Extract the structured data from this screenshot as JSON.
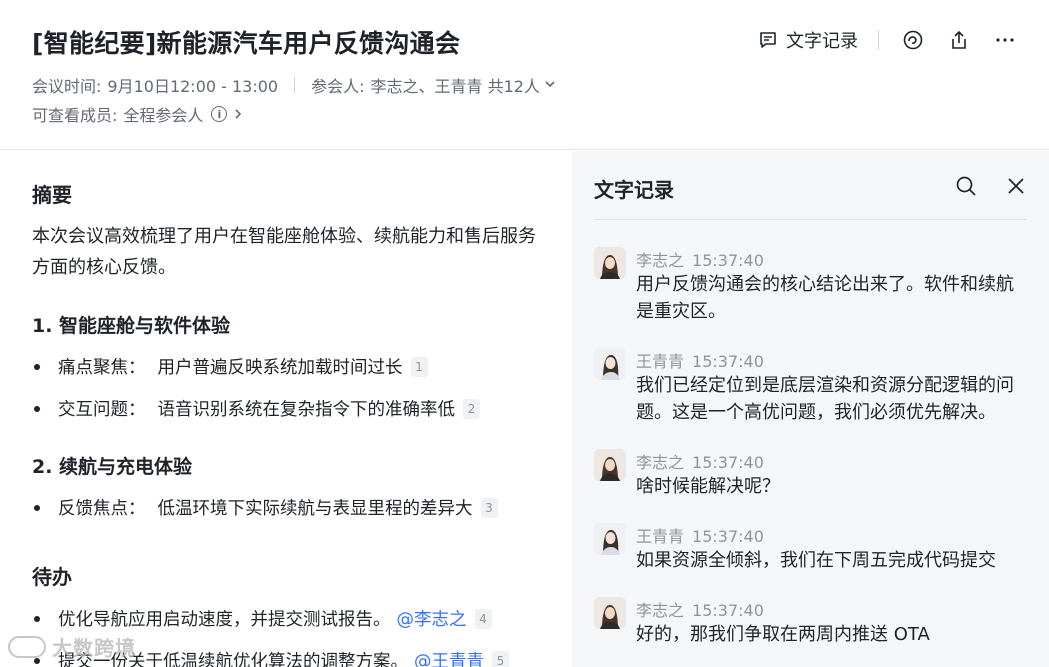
{
  "header": {
    "title": "[智能纪要]新能源汽车用户反馈沟通会",
    "meeting_time_label": "会议时间:",
    "meeting_time_value": "9月10日12:00 - 13:00",
    "participants_label": "参会人:",
    "participants_value": "李志之、王青青 共12人",
    "viewers_label": "可查看成员:",
    "viewers_value": "全程参会人",
    "transcript_button": "文字记录"
  },
  "summary": {
    "title": "摘要",
    "intro": "本次会议高效梳理了用户在智能座舱体验、续航能力和售后服务方面的核心反馈。",
    "sections": [
      {
        "heading": "1. 智能座舱与软件体验",
        "items": [
          {
            "label": "痛点聚焦：",
            "text": "用户普遍反映系统加载时间过长",
            "ref": "1"
          },
          {
            "label": "交互问题：",
            "text": "语音识别系统在复杂指令下的准确率低",
            "ref": "2"
          }
        ]
      },
      {
        "heading": "2. 续航与充电体验",
        "items": [
          {
            "label": "反馈焦点：",
            "text": "低温环境下实际续航与表显里程的差异大",
            "ref": "3"
          }
        ]
      }
    ]
  },
  "todo": {
    "title": "待办",
    "items": [
      {
        "text": "优化导航应用启动速度，并提交测试报告。",
        "mention": "@李志之",
        "ref": "4"
      },
      {
        "text": "提交一份关于低温续航优化算法的调整方案。",
        "mention": "@王青青",
        "ref": "5"
      }
    ]
  },
  "watermark": "大数跨境",
  "transcript": {
    "title": "文字记录",
    "messages": [
      {
        "speaker": "李志之",
        "time": "15:37:40",
        "text": "用户反馈沟通会的核心结论出来了。软件和续航是重灾区。"
      },
      {
        "speaker": "王青青",
        "time": "15:37:40",
        "text": "我们已经定位到是底层渲染和资源分配逻辑的问题。这是一个高优问题，我们必须优先解决。"
      },
      {
        "speaker": "李志之",
        "time": "15:37:40",
        "text": "啥时候能解决呢？"
      },
      {
        "speaker": "王青青",
        "time": "15:37:40",
        "text": "如果资源全倾斜，我们在下周五完成代码提交"
      },
      {
        "speaker": "李志之",
        "time": "15:37:40",
        "text": "好的，那我们争取在两周内推送 OTA"
      }
    ]
  }
}
